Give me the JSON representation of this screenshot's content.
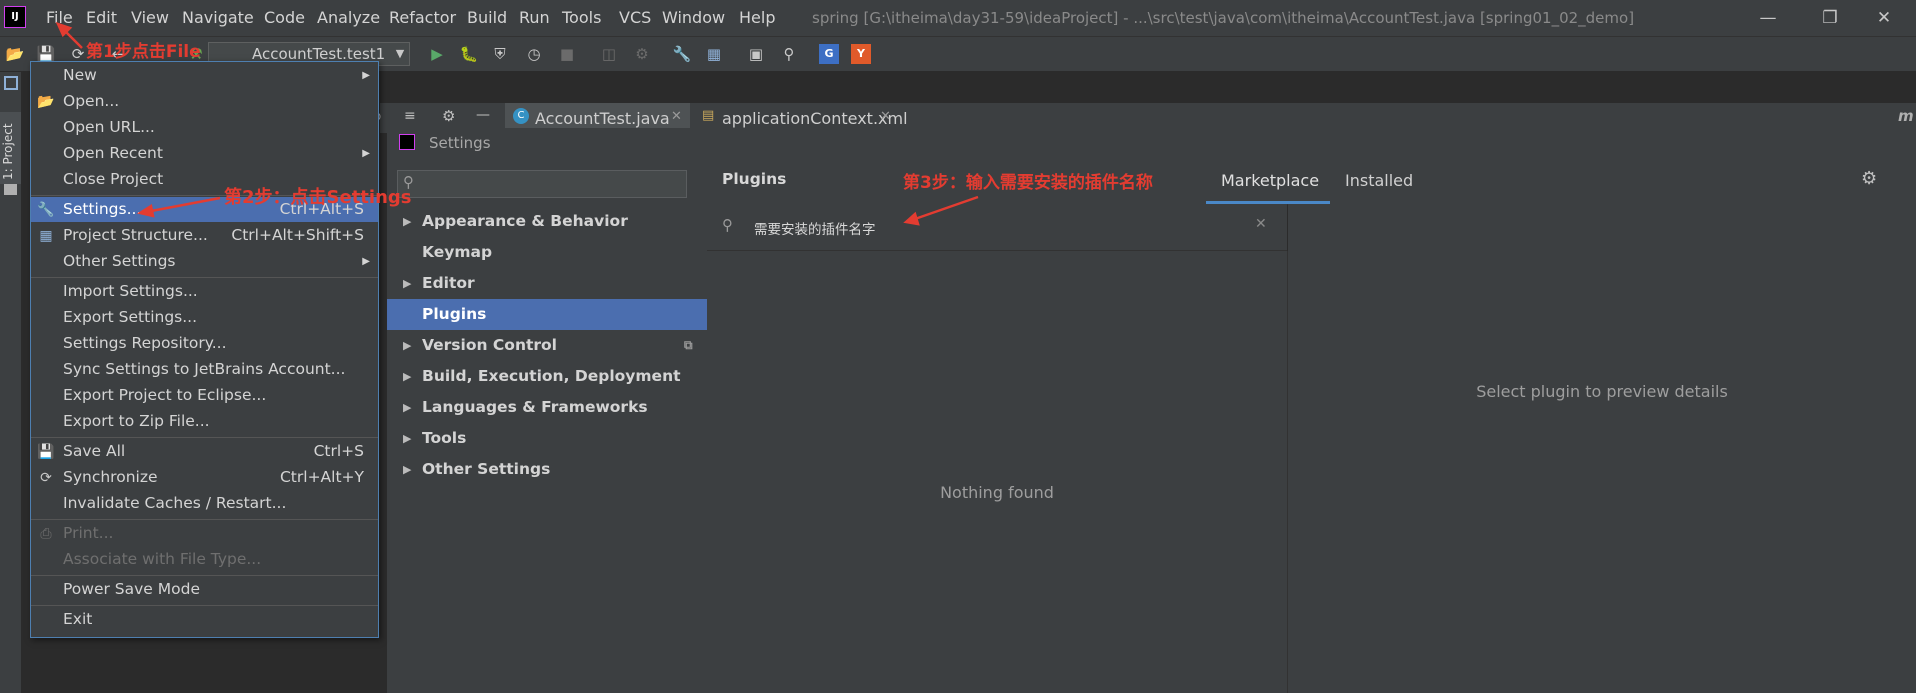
{
  "menubar": {
    "items": [
      "File",
      "Edit",
      "View",
      "Navigate",
      "Code",
      "Analyze",
      "Refactor",
      "Build",
      "Run",
      "Tools",
      "VCS",
      "Window",
      "Help"
    ],
    "window_title": "spring [G:\\itheima\\day31-59\\ideaProject] - ...\\src\\test\\java\\com\\itheima\\AccountTest.java [spring01_02_demo]"
  },
  "toolbar": {
    "run_config": "AccountTest.test1"
  },
  "sidebar": {
    "project_tab": "1: Project"
  },
  "editor_tabs": [
    "AccountTest.java",
    "applicationContext.xml"
  ],
  "file_menu": {
    "items": [
      {
        "label": "New",
        "shortcut": "",
        "submenu": true
      },
      {
        "label": "Open...",
        "shortcut": ""
      },
      {
        "label": "Open URL...",
        "shortcut": ""
      },
      {
        "label": "Open Recent",
        "shortcut": "",
        "submenu": true
      },
      {
        "label": "Close Project",
        "shortcut": ""
      },
      {
        "label": "Settings...",
        "shortcut": "Ctrl+Alt+S"
      },
      {
        "label": "Project Structure...",
        "shortcut": "Ctrl+Alt+Shift+S"
      },
      {
        "label": "Other Settings",
        "shortcut": "",
        "submenu": true
      },
      {
        "label": "Import Settings...",
        "shortcut": ""
      },
      {
        "label": "Export Settings...",
        "shortcut": ""
      },
      {
        "label": "Settings Repository...",
        "shortcut": ""
      },
      {
        "label": "Sync Settings to JetBrains Account...",
        "shortcut": ""
      },
      {
        "label": "Export Project to Eclipse...",
        "shortcut": ""
      },
      {
        "label": "Export to Zip File...",
        "shortcut": ""
      },
      {
        "label": "Save All",
        "shortcut": "Ctrl+S"
      },
      {
        "label": "Synchronize",
        "shortcut": "Ctrl+Alt+Y"
      },
      {
        "label": "Invalidate Caches / Restart...",
        "shortcut": ""
      },
      {
        "label": "Print...",
        "shortcut": ""
      },
      {
        "label": "Associate with File Type...",
        "shortcut": ""
      },
      {
        "label": "Power Save Mode",
        "shortcut": ""
      },
      {
        "label": "Exit",
        "shortcut": ""
      }
    ]
  },
  "settings": {
    "title": "Settings",
    "tree": [
      "Appearance & Behavior",
      "Keymap",
      "Editor",
      "Plugins",
      "Version Control",
      "Build, Execution, Deployment",
      "Languages & Frameworks",
      "Tools",
      "Other Settings"
    ],
    "plugins_label": "Plugins",
    "tabs": {
      "marketplace": "Marketplace",
      "installed": "Installed"
    },
    "search_value": "需要安装的插件名字",
    "empty_text": "Nothing found",
    "details_text": "Select plugin to preview details"
  },
  "annotations": {
    "step1": "第1步点击File",
    "step2": "第2步：点击Settings",
    "step3": "第3步：输入需要安装的插件名称"
  },
  "colors": {
    "accent": "#4b6eaf",
    "annotation": "#e33c31",
    "tab_underline": "#4a88c7"
  }
}
